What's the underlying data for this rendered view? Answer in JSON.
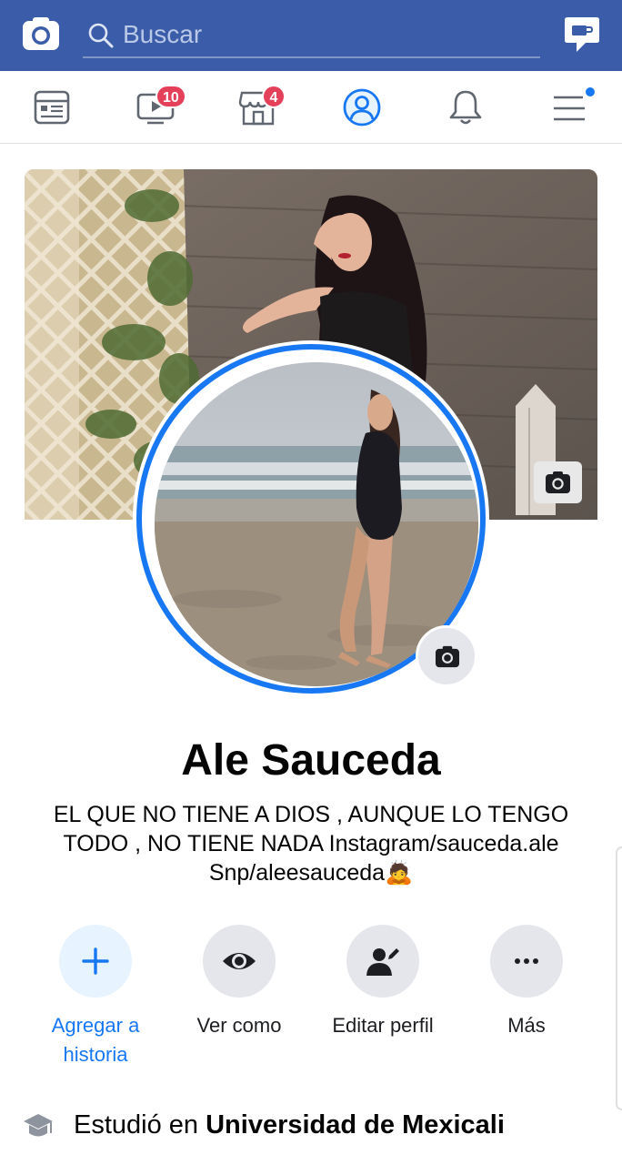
{
  "search": {
    "placeholder": "Buscar"
  },
  "nav": {
    "watch_badge": "10",
    "marketplace_badge": "4"
  },
  "profile": {
    "name": "Ale Sauceda",
    "bio_lines": [
      "EL QUE NO TIENE A DIOS , AUNQUE LO TENGO",
      "TODO , NO TIENE NADA Instagram/sauceda.ale",
      "Snp/aleesauceda"
    ],
    "bio_emoji": "🙇"
  },
  "actions": [
    {
      "label_1": "Agregar a",
      "label_2": "historia",
      "icon": "plus-icon"
    },
    {
      "label_1": "Ver como",
      "icon": "eye-icon"
    },
    {
      "label_1": "Editar perfil",
      "icon": "edit-profile-icon"
    },
    {
      "label_1": "Más",
      "icon": "more-icon"
    }
  ],
  "education": {
    "prefix": "Estudió en ",
    "school": "Universidad de Mexicali"
  },
  "colors": {
    "brand_bar": "#3b5ca8",
    "accent": "#1877f2",
    "badge": "#e4405a"
  }
}
